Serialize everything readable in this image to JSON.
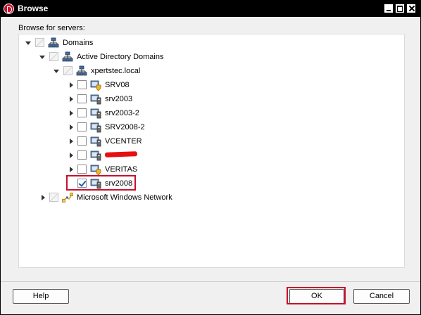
{
  "window": {
    "title": "Browse"
  },
  "browse_label": "Browse for servers:",
  "tree": [
    {
      "label": "Domains",
      "icon": "network-icon",
      "expanded": true,
      "checkbox": "indeterminate"
    },
    {
      "label": "Active Directory Domains",
      "icon": "network-icon",
      "expanded": true,
      "checkbox": "indeterminate"
    },
    {
      "label": "xpertstec.local",
      "icon": "network-icon",
      "expanded": true,
      "checkbox": "indeterminate"
    },
    {
      "label": "SRV08",
      "icon": "server-shield-icon",
      "checkbox": "unchecked"
    },
    {
      "label": "srv2003",
      "icon": "computer-icon",
      "checkbox": "unchecked"
    },
    {
      "label": "srv2003-2",
      "icon": "computer-icon",
      "checkbox": "unchecked"
    },
    {
      "label": "SRV2008-2",
      "icon": "computer-icon",
      "checkbox": "unchecked"
    },
    {
      "label": "VCENTER",
      "icon": "computer-icon",
      "checkbox": "unchecked"
    },
    {
      "label": "",
      "icon": "computer-icon",
      "checkbox": "unchecked",
      "redacted": true
    },
    {
      "label": "VERITAS",
      "icon": "server-shield-icon",
      "checkbox": "unchecked"
    },
    {
      "label": "srv2008",
      "icon": "computer-icon",
      "checkbox": "checked"
    },
    {
      "label": "Microsoft Windows Network",
      "icon": "windows-network-icon",
      "expanded": false,
      "checkbox": "unchecked"
    }
  ],
  "buttons": {
    "help": "Help",
    "ok": "OK",
    "cancel": "Cancel"
  },
  "colors": {
    "highlight": "#c8102e",
    "titlebar": "#000000",
    "check": "#1e5bb5"
  }
}
